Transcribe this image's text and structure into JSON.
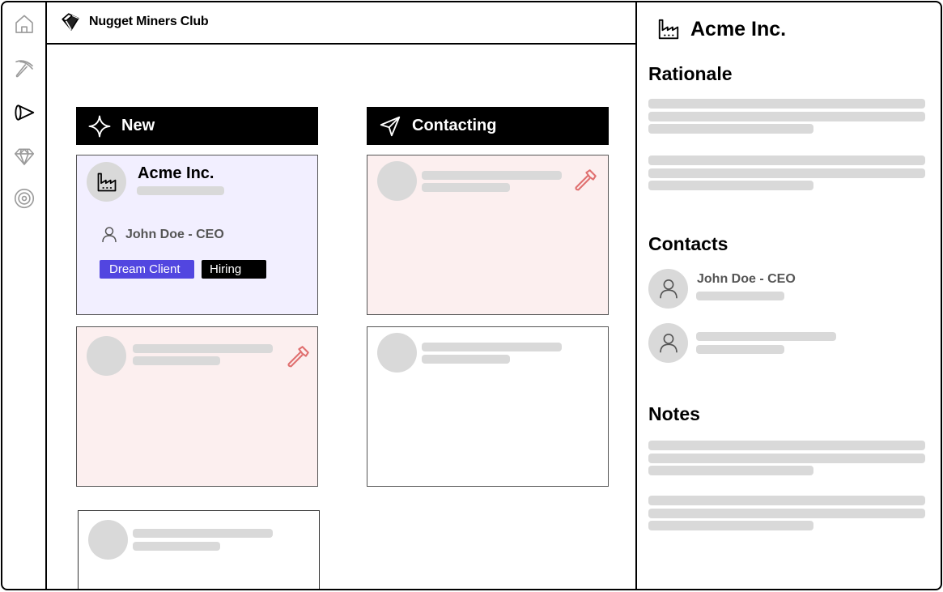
{
  "app": {
    "name": "Nugget Miners Club",
    "logo_icon": "gold-nugget-icon"
  },
  "sidebar": {
    "items": [
      {
        "id": "home",
        "icon": "home-icon",
        "active": false
      },
      {
        "id": "mine",
        "icon": "pickaxe-icon",
        "active": false
      },
      {
        "id": "pipeline",
        "icon": "megaphone-icon",
        "active": true
      },
      {
        "id": "gems",
        "icon": "diamond-icon",
        "active": false
      },
      {
        "id": "targets",
        "icon": "target-icon",
        "active": false
      }
    ]
  },
  "board": {
    "columns": [
      {
        "label": "New",
        "icon": "sparkle-icon",
        "cards": [
          {
            "company": "Acme Inc.",
            "icon": "factory-icon",
            "contact": "John Doe - CEO",
            "tags": [
              {
                "label": "Dream Client",
                "color": "#5246e0"
              },
              {
                "label": "Hiring",
                "color": "#000000"
              }
            ],
            "state": "selected"
          },
          {
            "state": "flagged",
            "flag_icon": "hammer-icon",
            "placeholder": true
          },
          {
            "state": "plain",
            "placeholder": true
          }
        ]
      },
      {
        "label": "Contacting",
        "icon": "send-icon",
        "cards": [
          {
            "state": "flagged",
            "flag_icon": "hammer-icon",
            "placeholder": true
          },
          {
            "state": "plain",
            "placeholder": true
          }
        ]
      }
    ]
  },
  "detail": {
    "company": "Acme Inc.",
    "icon": "factory-icon",
    "sections": {
      "rationale": "Rationale",
      "contacts": "Contacts",
      "notes": "Notes"
    },
    "contacts": [
      {
        "name": "John Doe - CEO"
      },
      {
        "name": ""
      }
    ]
  },
  "colors": {
    "accent": "#5246e0",
    "selected_card": "#f2efff",
    "flagged_card": "#fcefef",
    "flag_icon": "#e07070",
    "placeholder": "#d9d9d9"
  }
}
